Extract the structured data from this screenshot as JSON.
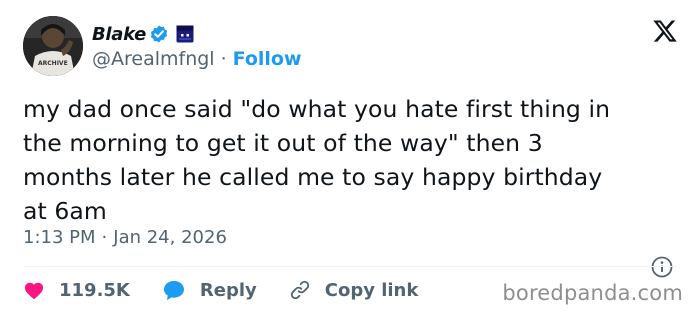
{
  "author": {
    "display_name": "Blake",
    "handle": "@Arealmfngl",
    "separator": "·",
    "follow_label": "Follow",
    "avatar_shirt_text": "ARCHIVE",
    "verified_color": "#1d9bf0",
    "badge_icon": "square-emoji-icon"
  },
  "tweet": {
    "text_lines": [
      "my dad once said \"do what you hate first thing in",
      "the morning to get it out of the way\" then 3",
      "months later he called me to say happy birthday",
      "at 6am"
    ],
    "time": "1:13 PM",
    "separator": "·",
    "date": "Jan 24, 2026"
  },
  "actions": {
    "likes": "119.5K",
    "reply_label": "Reply",
    "copy_link_label": "Copy link"
  },
  "watermark": "boredpanda.com",
  "colors": {
    "accent": "#1d9bf0",
    "like": "#f91880",
    "text": "#0f1419",
    "muted": "#536471"
  }
}
